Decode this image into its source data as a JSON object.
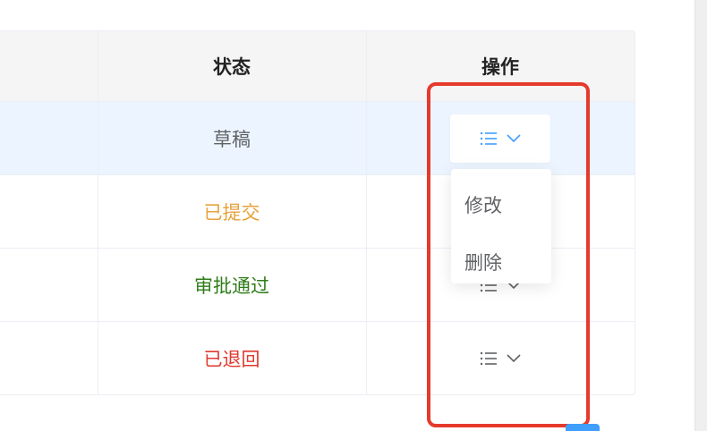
{
  "colors": {
    "draft": "#606266",
    "submitted": "#e6a23c",
    "approved": "#2f7d1a",
    "returned": "#e0392f",
    "accent": "#409eff",
    "highlight": "#e53a2c"
  },
  "table": {
    "headers": {
      "status": "状态",
      "action": "操作"
    },
    "rows": [
      {
        "status": "草稿"
      },
      {
        "status": "已提交"
      },
      {
        "status": "审批通过"
      },
      {
        "status": "已退回"
      }
    ]
  },
  "dropdown": {
    "items": [
      {
        "label": "修改"
      },
      {
        "label": "删除"
      }
    ]
  },
  "icons": {
    "action_trigger": "list-icon",
    "caret": "chevron-down-icon"
  }
}
